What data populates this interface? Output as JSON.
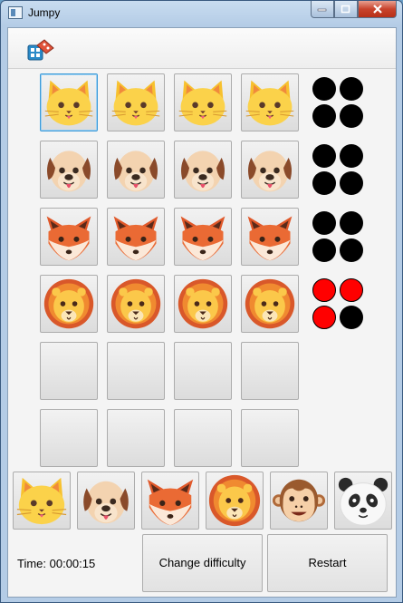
{
  "window": {
    "title": "Jumpy"
  },
  "toolbar": {
    "difficulty_icon": "dice-icon"
  },
  "board": {
    "rows": [
      {
        "animal": "cat",
        "score": [
          "black",
          "black",
          "black",
          "black"
        ]
      },
      {
        "animal": "dog",
        "score": [
          "black",
          "black",
          "black",
          "black"
        ]
      },
      {
        "animal": "fox",
        "score": [
          "black",
          "black",
          "black",
          "black"
        ]
      },
      {
        "animal": "lion",
        "score": [
          "red",
          "red",
          "red",
          "black"
        ]
      },
      {
        "animal": "",
        "score": []
      },
      {
        "animal": "",
        "score": []
      }
    ],
    "selected": {
      "row": 0,
      "col": 0
    }
  },
  "palette": [
    "cat",
    "dog",
    "fox",
    "lion",
    "monkey",
    "panda"
  ],
  "footer": {
    "time": "Time: 00:00:15",
    "change_difficulty_label": "Change difficulty",
    "restart_label": "Restart"
  },
  "colors": {
    "selection": "#3c9ad8",
    "red_dot": "#ff0000"
  }
}
